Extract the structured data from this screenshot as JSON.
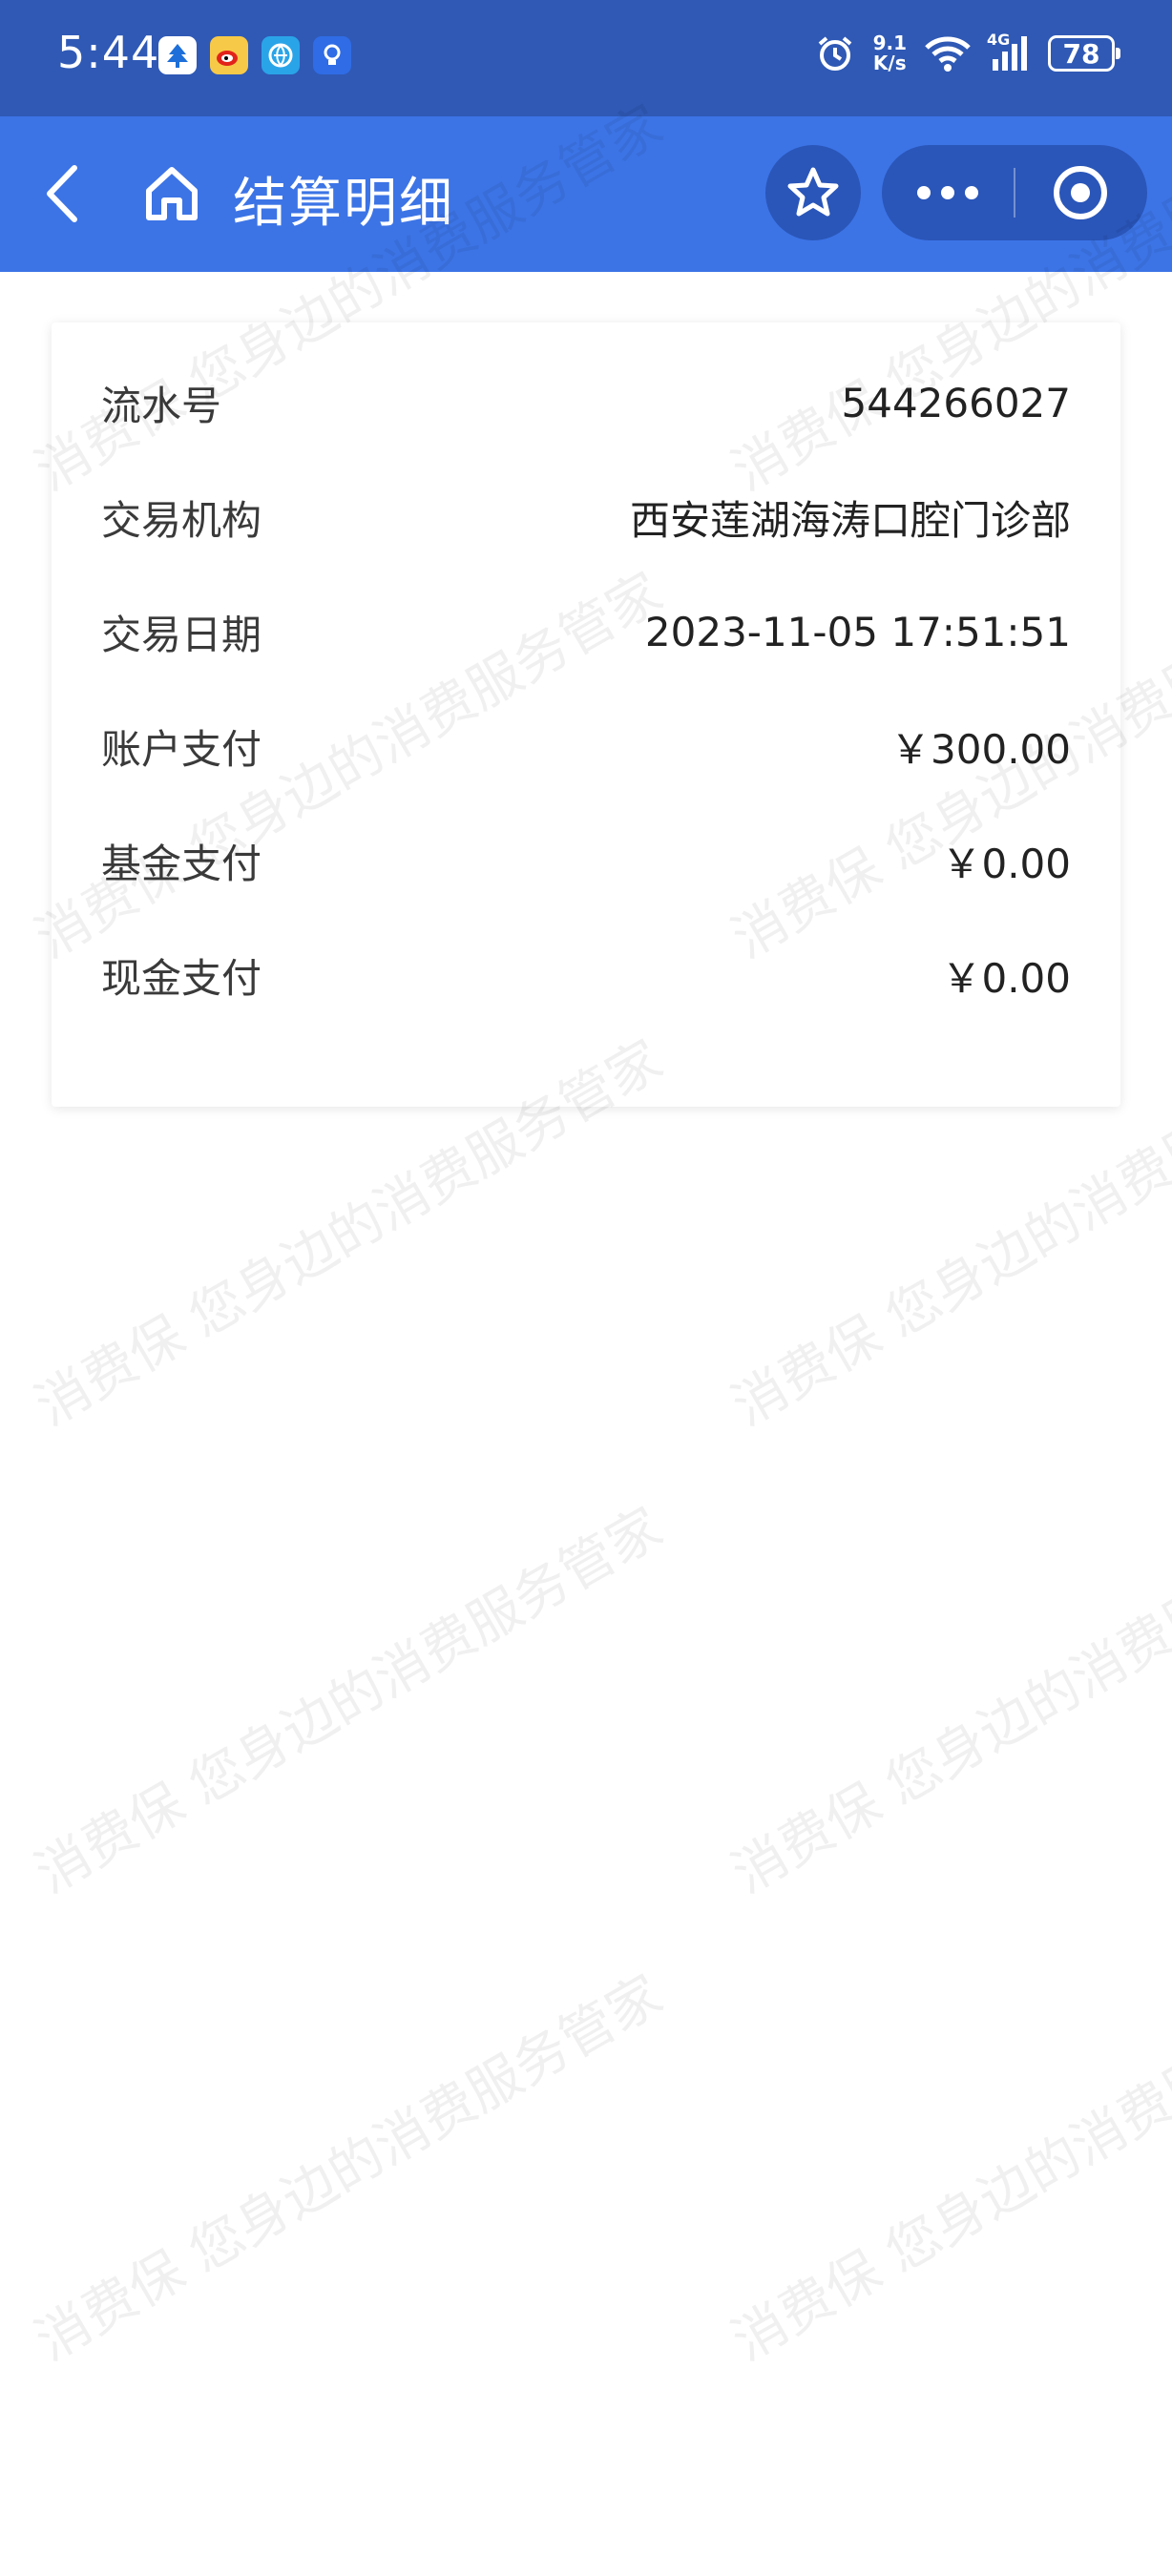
{
  "status_bar": {
    "time": "5:44",
    "net_speed_value": "9.1",
    "net_speed_unit": "K/s",
    "network_type": "4G",
    "battery": "78",
    "app_icons": [
      "tree-app-icon",
      "weibo-icon",
      "browser-icon",
      "bulb-app-icon"
    ]
  },
  "nav": {
    "title": "结算明细"
  },
  "details": {
    "rows": [
      {
        "label": "流水号",
        "value": "544266027"
      },
      {
        "label": "交易机构",
        "value": "西安莲湖海涛口腔门诊部"
      },
      {
        "label": "交易日期",
        "value": "2023-11-05 17:51:51"
      },
      {
        "label": "账户支付",
        "value": "￥300.00"
      },
      {
        "label": "基金支付",
        "value": "￥0.00"
      },
      {
        "label": "现金支付",
        "value": "￥0.00"
      }
    ]
  },
  "watermark": {
    "text": "消费保 您身边的消费服务管家"
  },
  "colors": {
    "status_bar": "#2f59b5",
    "nav_bar": "#3c74e6",
    "nav_button_bg": "#2a56b9"
  }
}
